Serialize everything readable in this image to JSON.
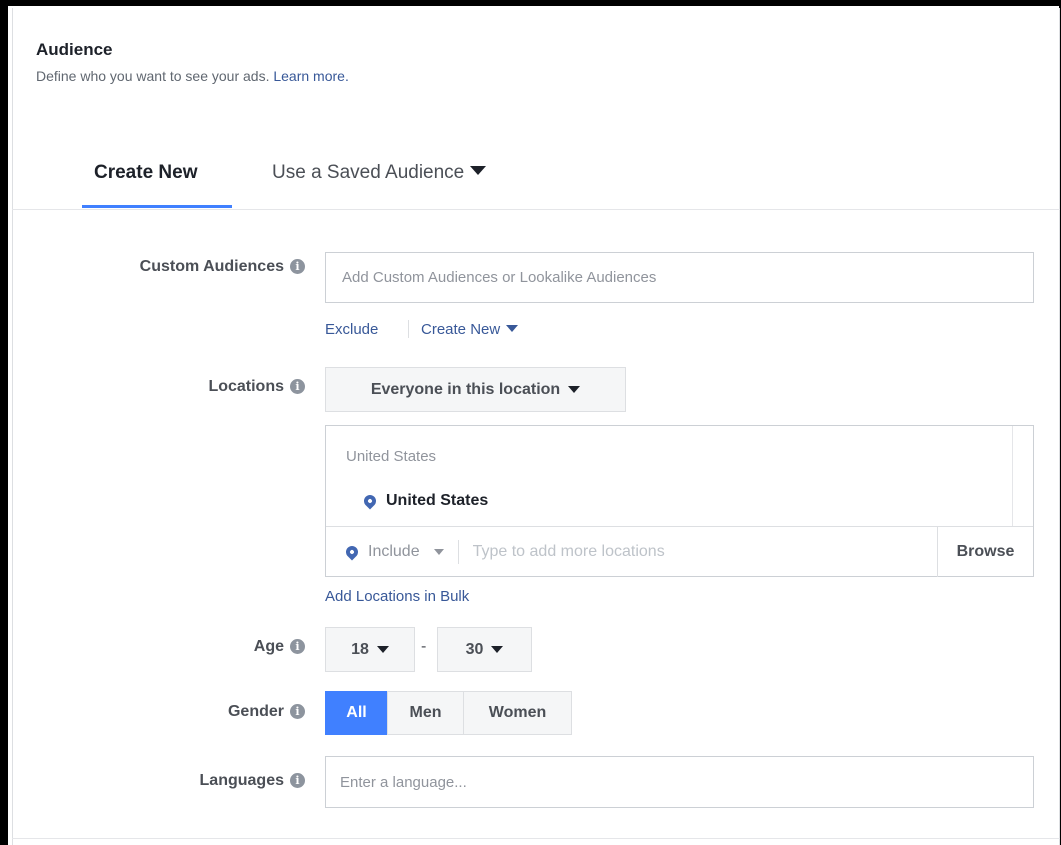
{
  "header": {
    "title": "Audience",
    "subtitle": "Define who you want to see your ads.",
    "learn_more": "Learn more."
  },
  "tabs": [
    {
      "label": "Create New",
      "active": true
    },
    {
      "label": "Use a Saved Audience",
      "active": false
    }
  ],
  "custom_audiences": {
    "label": "Custom Audiences",
    "placeholder": "Add Custom Audiences or Lookalike Audiences",
    "exclude": "Exclude",
    "create_new": "Create New"
  },
  "locations": {
    "label": "Locations",
    "dropdown": "Everyone in this location",
    "group_label": "United States",
    "selected": "United States",
    "include": "Include",
    "placeholder": "Type to add more locations",
    "browse": "Browse",
    "bulk": "Add Locations in Bulk"
  },
  "age": {
    "label": "Age",
    "min": "18",
    "separator": "-",
    "max": "30"
  },
  "gender": {
    "label": "Gender",
    "options": [
      "All",
      "Men",
      "Women"
    ],
    "selected": "All"
  },
  "languages": {
    "label": "Languages",
    "placeholder": "Enter a language..."
  },
  "colors": {
    "accent": "#4080ff",
    "link": "#385898"
  }
}
